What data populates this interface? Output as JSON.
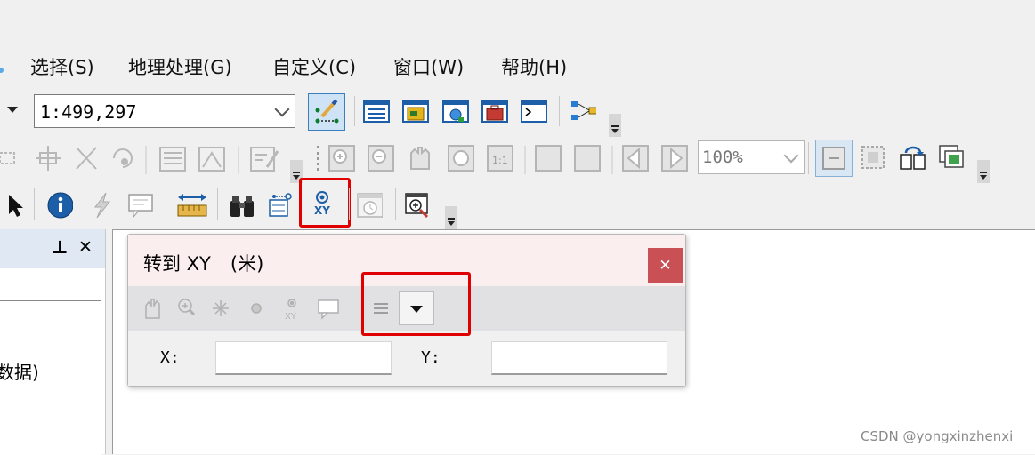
{
  "menu": {
    "items": [
      "选择(S)",
      "地理处理(G)",
      "自定义(C)",
      "窗口(W)",
      "帮助(H)"
    ]
  },
  "standard_toolbar": {
    "scale_value": "1:499,297"
  },
  "layout_toolbar": {
    "zoom_value": "100%"
  },
  "tools_toolbar": {
    "goto_xy_label": "XY"
  },
  "left_panel": {
    "pin_glyph": "⊥",
    "close_glyph": "✕",
    "partial_text": "数据)"
  },
  "goto_dialog": {
    "title": "转到 XY",
    "units": "(米)",
    "close_glyph": "✕",
    "x_label": "X:",
    "y_label": "Y:",
    "x_value": "",
    "y_value": "",
    "tool_icons": [
      "pan-icon",
      "zoom-to-icon",
      "flash-icon",
      "add-point-icon",
      "add-labeled-point-icon",
      "add-callout-icon",
      "recent-list-icon",
      "units-dropdown-icon"
    ]
  },
  "watermark": "CSDN @yongxinzhenxi",
  "colors": {
    "highlight_box": "#e00000",
    "dialog_title_bg": "#faeeee",
    "dialog_close_bg": "#c95055",
    "toc_header_bg": "#dfe8f3",
    "menu_accent": "#5aa9e6"
  }
}
